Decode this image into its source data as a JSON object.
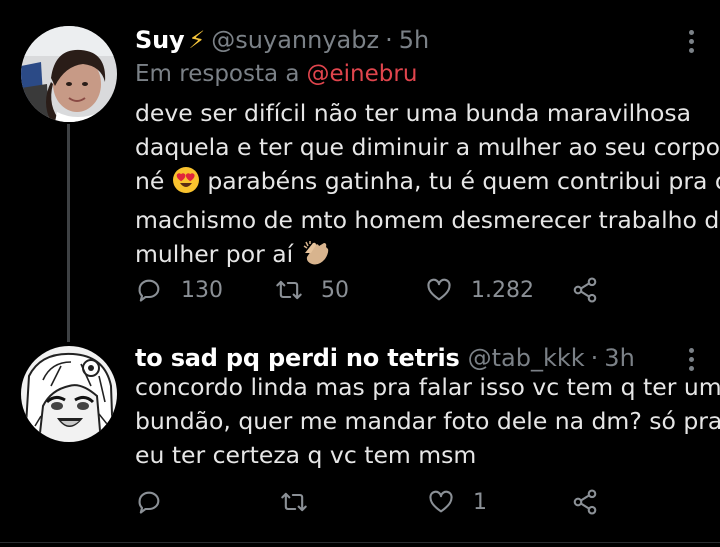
{
  "tweets": [
    {
      "author": {
        "name": "Suy",
        "badge": "⚡",
        "handle": "@suyannyabz",
        "time": "5h",
        "avatar": "profile-photo"
      },
      "reply_to": {
        "prefix": "Em resposta a",
        "mention": "@einebru"
      },
      "text_lines": [
        "deve ser difícil não ter uma bunda maravilhosa",
        "daquela e ter que diminuir a mulher ao seu corpo",
        "né",
        "parabéns gatinha, tu é quem contribui pra o",
        "machismo de mto homem desmerecer trabalho de",
        "mulher por aí"
      ],
      "emojis": [
        "heart-eyes-emoji",
        "clapping-hands-emoji"
      ],
      "actions": {
        "replies": "130",
        "retweets": "50",
        "likes": "1.282"
      }
    },
    {
      "author": {
        "name": "to sad pq perdi no tetris",
        "handle": "@tab_kkk",
        "time": "3h",
        "avatar": "anime-drawing"
      },
      "text_lines": [
        "concordo linda mas pra falar isso vc tem q ter um",
        "bundão, quer me mandar foto dele na dm? só pra",
        "eu ter certeza q vc tem msm"
      ],
      "actions": {
        "replies": "",
        "retweets": "",
        "likes": "1"
      }
    }
  ],
  "meta": {
    "separator": "·"
  },
  "colors": {
    "background": "#000000",
    "text": "#e6e6e6",
    "muted": "#7b8187",
    "mention": "#e0454d",
    "badge": "#f5c43b"
  },
  "icons": [
    "reply-icon",
    "retweet-icon",
    "like-icon",
    "share-icon",
    "more-options-icon"
  ]
}
